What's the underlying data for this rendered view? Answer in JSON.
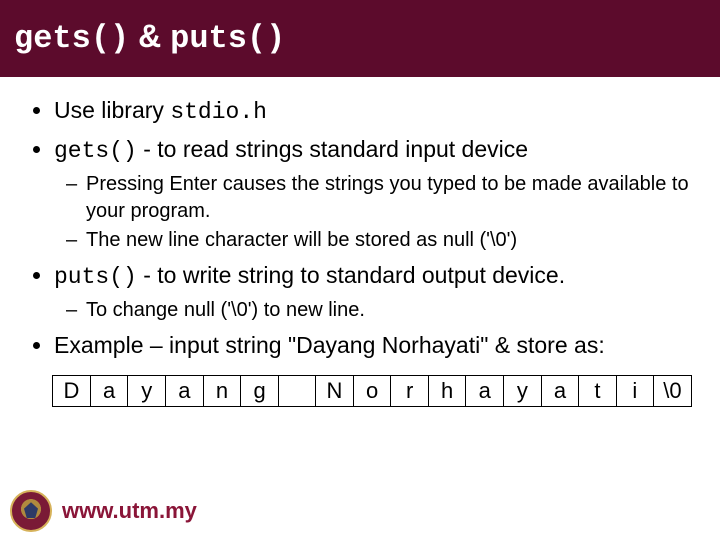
{
  "title": {
    "prefix_code": "gets()",
    "connector": " & ",
    "suffix_code": "puts()"
  },
  "bullets": {
    "b1_pre": "Use library ",
    "b1_code": "stdio.h",
    "b2_code": "gets()",
    "b2_post": " - to read strings standard input device",
    "b2_sub1": "Pressing Enter causes the strings you typed to be made available to your program.",
    "b2_sub2": "The new line character will be stored as null ('\\0')",
    "b3_code": "puts()",
    "b3_post": " - to write string to standard output device.",
    "b3_sub1": "To change null ('\\0') to new line.",
    "b4": "Example – input string \"Dayang Norhayati\" & store as:"
  },
  "chars": [
    "D",
    "a",
    "y",
    "a",
    "n",
    "g",
    " ",
    "N",
    "o",
    "r",
    "h",
    "a",
    "y",
    "a",
    "t",
    "i",
    "\\0"
  ],
  "footer": {
    "site": "www.utm.my"
  }
}
